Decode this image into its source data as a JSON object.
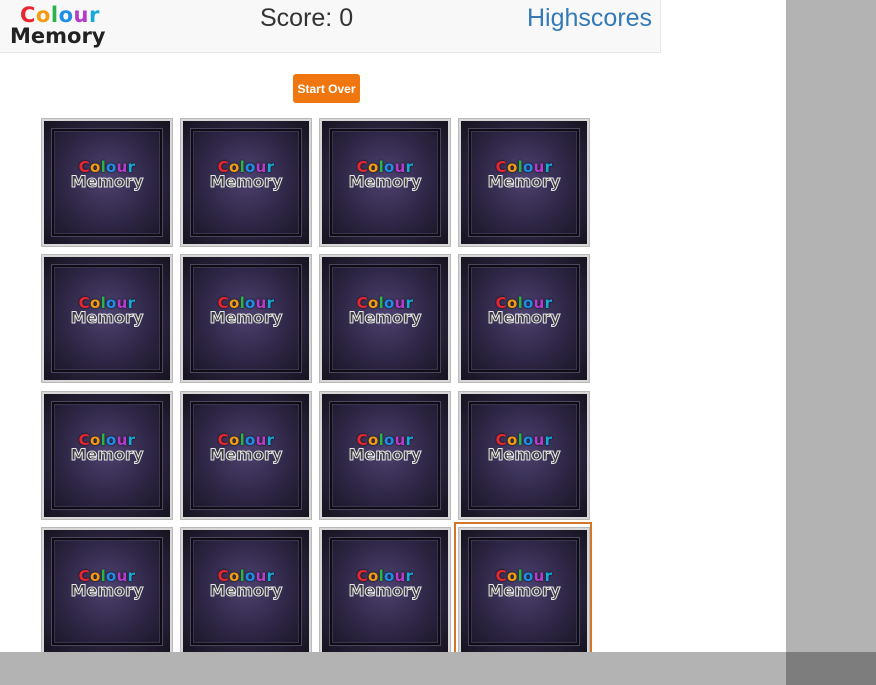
{
  "header": {
    "logo_line1": [
      "C",
      "o",
      "l",
      "o",
      "u",
      "r"
    ],
    "logo_line2": "Memory",
    "score_label": "Score: 0",
    "highscores_label": "Highscores"
  },
  "controls": {
    "start_over_label": "Start Over"
  },
  "board": {
    "rows": 4,
    "cols": 4,
    "card_face_text_line1": "Colour",
    "card_face_text_line2": "Memory",
    "selected_card_index": 15
  },
  "colors": {
    "accent_orange": "#f0770f",
    "selection_border": "#d2772a",
    "link_blue": "#337ab7",
    "logo_letters": [
      "#e8262f",
      "#f39c12",
      "#2bb24c",
      "#1f8ee8",
      "#b33cc9",
      "#16a9d8"
    ]
  }
}
